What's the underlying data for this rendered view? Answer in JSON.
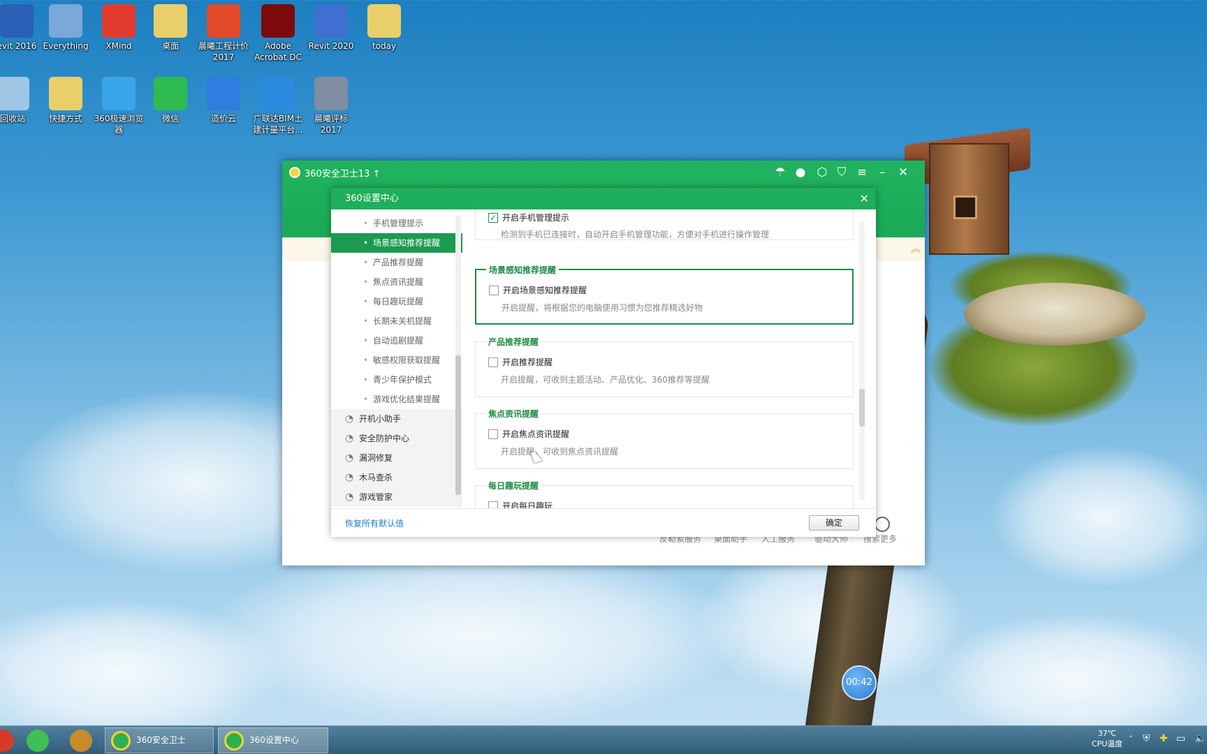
{
  "desktop": {
    "icons_row1": [
      {
        "label": "evit 2016",
        "icon": "revit-icon",
        "color": "#2a5fb5"
      },
      {
        "label": "Everything",
        "icon": "search-magnifier-icon",
        "color": "#7aa8d8"
      },
      {
        "label": "XMind",
        "icon": "xmind-icon",
        "color": "#e23b2e"
      },
      {
        "label": "桌面",
        "icon": "folder-icon",
        "color": "#e9cf6a"
      },
      {
        "label": "晨曦工程计价2017",
        "icon": "chenxi-pricing-icon",
        "color": "#e24a2a"
      },
      {
        "label": "Adobe Acrobat DC",
        "icon": "acrobat-icon",
        "color": "#7d0a0a"
      },
      {
        "label": "Revit 2020",
        "icon": "revit-icon",
        "color": "#3f6fd0"
      },
      {
        "label": "today",
        "icon": "folder-icon",
        "color": "#e9cf6a"
      }
    ],
    "icons_row2": [
      {
        "label": "回收站",
        "icon": "recycle-bin-icon",
        "color": "#9fc6e4"
      },
      {
        "label": "快捷方式",
        "icon": "folder-icon",
        "color": "#e9cf6a"
      },
      {
        "label": "360极速浏览器",
        "icon": "browser-360-icon",
        "color": "#38a5e8"
      },
      {
        "label": "微信",
        "icon": "wechat-icon",
        "color": "#2dbb4f"
      },
      {
        "label": "造价云",
        "icon": "cost-cloud-icon",
        "color": "#2f7de0"
      },
      {
        "label": "广联达BIM土建计量平台...",
        "icon": "glodon-bim-icon",
        "color": "#2a8ae0"
      },
      {
        "label": "晨曦评标2017",
        "icon": "chenxi-bid-icon",
        "color": "#7f8ea0"
      }
    ]
  },
  "main_window": {
    "title": "360安全卫士13 ↑",
    "controls": [
      "umbrella-icon",
      "avatar-icon",
      "skin-icon",
      "shirt-icon",
      "menu-icon",
      "minimize-icon",
      "close-icon"
    ],
    "bottom_links": [
      "反勒索服务",
      "桌面助手",
      "人工服务",
      "驱动大师",
      "搜索更多"
    ]
  },
  "dialog": {
    "title": "360设置中心",
    "nav": {
      "subitems": [
        "手机管理提示",
        "场景感知推荐提醒",
        "产品推荐提醒",
        "焦点资讯提醒",
        "每日趣玩提醒",
        "长期未关机提醒",
        "自动追剧提醒",
        "敏感权限获取提醒",
        "青少年保护模式",
        "游戏优化结果提醒"
      ],
      "active_index": 1,
      "topitems": [
        {
          "label": "开机小助手",
          "icon": "clock-icon"
        },
        {
          "label": "安全防护中心",
          "icon": "shield-grid-icon"
        },
        {
          "label": "漏洞修复",
          "icon": "patch-icon"
        },
        {
          "label": "木马查杀",
          "icon": "trojan-icon"
        },
        {
          "label": "游戏管家",
          "icon": "game-icon"
        }
      ]
    },
    "sections": [
      {
        "legend": "",
        "checkbox": "开启手机管理提示",
        "checked": true,
        "desc": "检测到手机已连接时，自动开启手机管理功能，方便对手机进行操作管理"
      },
      {
        "legend": "场景感知推荐提醒",
        "checkbox": "开启场景感知推荐提醒",
        "checked": false,
        "desc": "开启提醒，将根据您的电脑使用习惯为您推荐精选好物"
      },
      {
        "legend": "产品推荐提醒",
        "checkbox": "开启推荐提醒",
        "checked": false,
        "desc": "开启提醒，可收到主题活动、产品优化、360推荐等提醒"
      },
      {
        "legend": "焦点资讯提醒",
        "checkbox": "开启焦点资讯提醒",
        "checked": false,
        "desc": "开启提醒，可收到焦点资讯提醒"
      },
      {
        "legend": "每日趣玩提醒",
        "checkbox": "开启每日趣玩",
        "checked": false,
        "desc": ""
      }
    ],
    "footer": {
      "restore": "恢复所有默认值",
      "ok": "确定"
    }
  },
  "timer": "00:42",
  "taskbar": {
    "tasks": [
      "360安全卫士",
      "360设置中心"
    ],
    "temp": "37℃",
    "temp_label": "CPU温度"
  }
}
